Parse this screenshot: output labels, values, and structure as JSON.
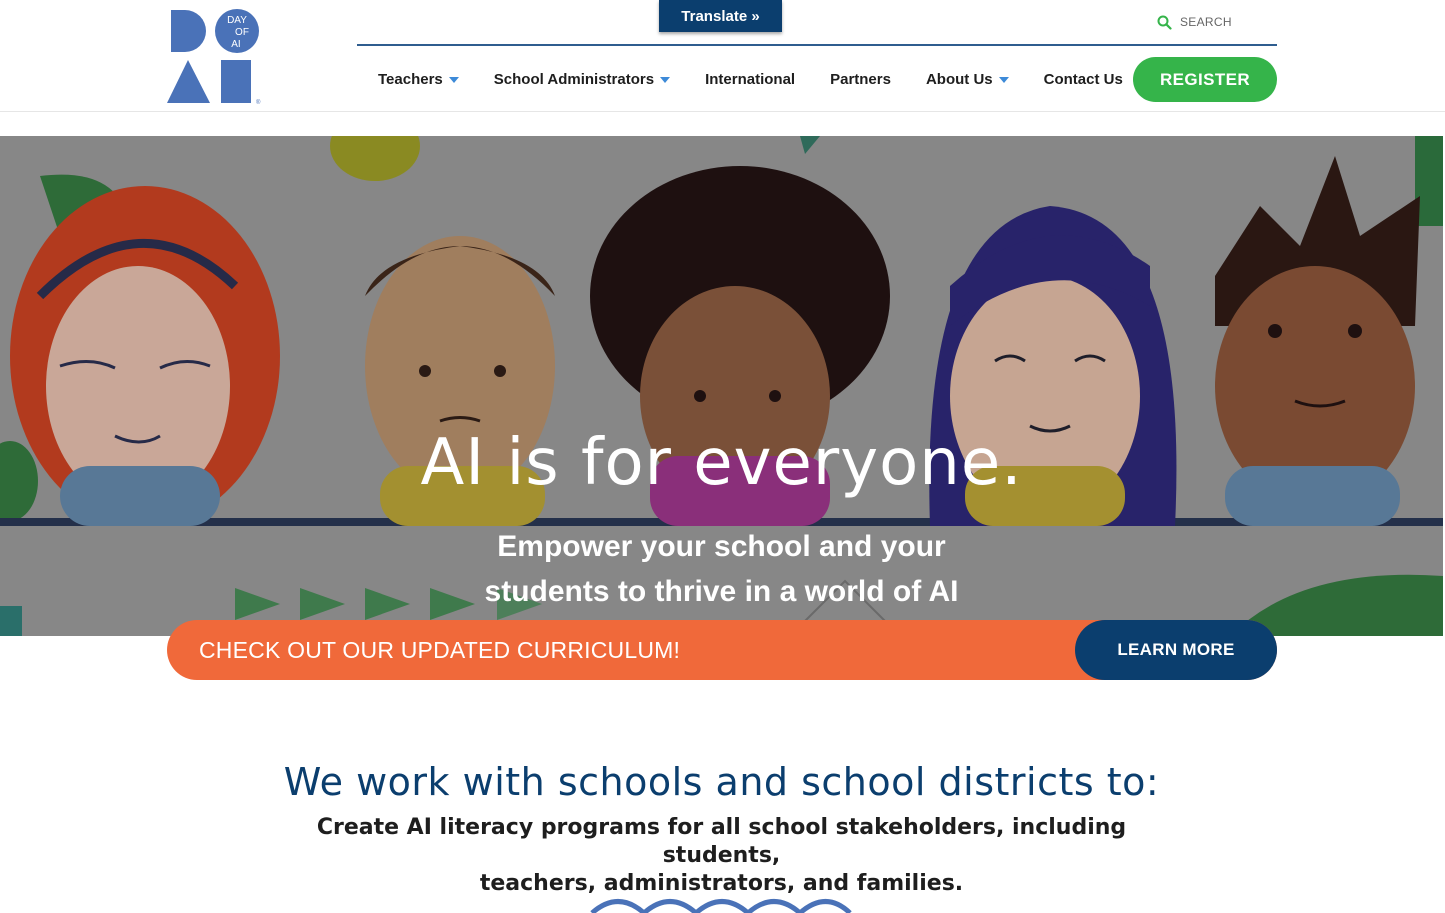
{
  "logo": {
    "text_line1": "DAY",
    "text_line2": "OF",
    "text_line3": "AI",
    "color": "#4a72b8"
  },
  "header": {
    "translate_label": "Translate »",
    "search_placeholder": "SEARCH",
    "nav": [
      {
        "label": "Teachers",
        "has_dropdown": true
      },
      {
        "label": "School Administrators",
        "has_dropdown": true
      },
      {
        "label": "International",
        "has_dropdown": false
      },
      {
        "label": "Partners",
        "has_dropdown": false
      },
      {
        "label": "About Us",
        "has_dropdown": true
      },
      {
        "label": "Contact Us",
        "has_dropdown": false
      }
    ],
    "register_label": "REGISTER"
  },
  "hero": {
    "title": "AI is for everyone.",
    "subtitle_line1": "Empower your school and your",
    "subtitle_line2": "students to thrive in a world of AI"
  },
  "banner": {
    "text": "CHECK OUT OUR UPDATED CURRICULUM!",
    "button_label": "LEARN MORE"
  },
  "mission": {
    "title": "We work with schools and school districts to:",
    "text_line1": "Create AI literacy programs for all school stakeholders, including students,",
    "text_line2": "teachers, administrators, and families."
  },
  "colors": {
    "navy": "#0b3e6e",
    "green": "#35b44a",
    "orange": "#f0693a",
    "logo_blue": "#4a72b8",
    "caret_blue": "#3d8ad8"
  },
  "icons": [
    "search-icon",
    "chevron-down-icon",
    "wave-divider-icon"
  ]
}
